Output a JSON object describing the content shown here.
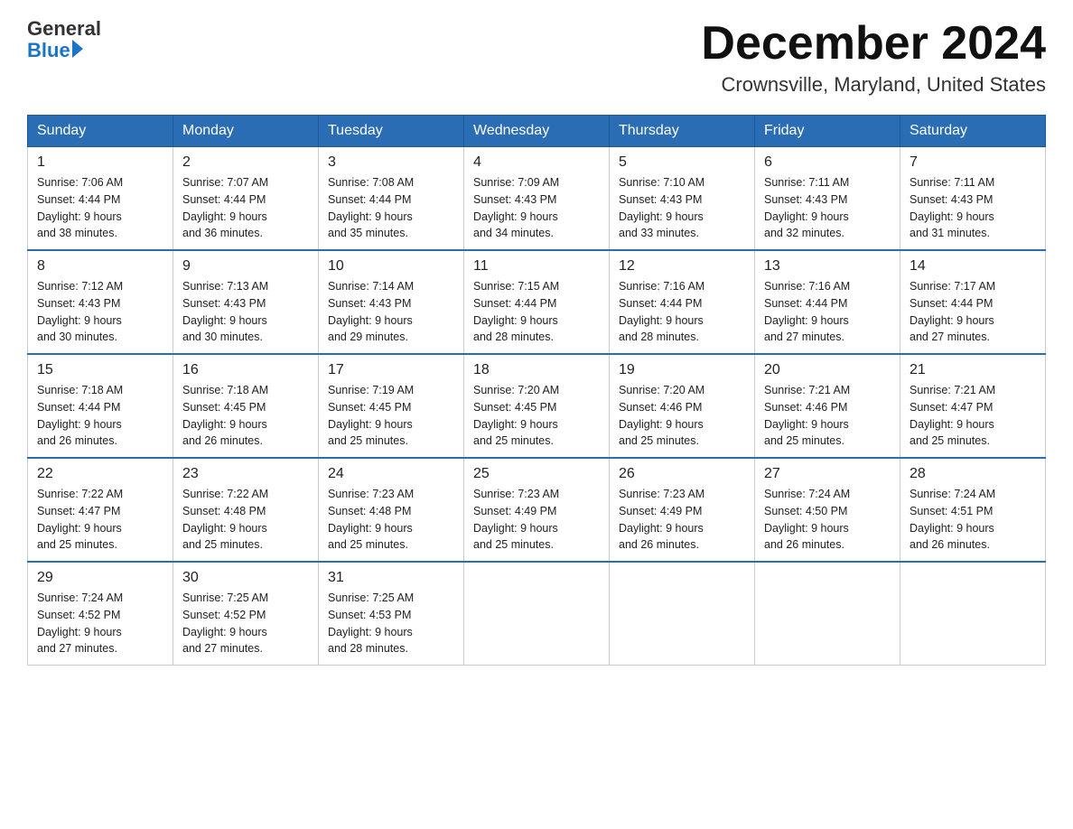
{
  "header": {
    "logo_text1": "General",
    "logo_text2": "Blue",
    "month_title": "December 2024",
    "location": "Crownsville, Maryland, United States"
  },
  "weekdays": [
    "Sunday",
    "Monday",
    "Tuesday",
    "Wednesday",
    "Thursday",
    "Friday",
    "Saturday"
  ],
  "weeks": [
    [
      {
        "day": "1",
        "sunrise": "7:06 AM",
        "sunset": "4:44 PM",
        "daylight": "9 hours and 38 minutes."
      },
      {
        "day": "2",
        "sunrise": "7:07 AM",
        "sunset": "4:44 PM",
        "daylight": "9 hours and 36 minutes."
      },
      {
        "day": "3",
        "sunrise": "7:08 AM",
        "sunset": "4:44 PM",
        "daylight": "9 hours and 35 minutes."
      },
      {
        "day": "4",
        "sunrise": "7:09 AM",
        "sunset": "4:43 PM",
        "daylight": "9 hours and 34 minutes."
      },
      {
        "day": "5",
        "sunrise": "7:10 AM",
        "sunset": "4:43 PM",
        "daylight": "9 hours and 33 minutes."
      },
      {
        "day": "6",
        "sunrise": "7:11 AM",
        "sunset": "4:43 PM",
        "daylight": "9 hours and 32 minutes."
      },
      {
        "day": "7",
        "sunrise": "7:11 AM",
        "sunset": "4:43 PM",
        "daylight": "9 hours and 31 minutes."
      }
    ],
    [
      {
        "day": "8",
        "sunrise": "7:12 AM",
        "sunset": "4:43 PM",
        "daylight": "9 hours and 30 minutes."
      },
      {
        "day": "9",
        "sunrise": "7:13 AM",
        "sunset": "4:43 PM",
        "daylight": "9 hours and 30 minutes."
      },
      {
        "day": "10",
        "sunrise": "7:14 AM",
        "sunset": "4:43 PM",
        "daylight": "9 hours and 29 minutes."
      },
      {
        "day": "11",
        "sunrise": "7:15 AM",
        "sunset": "4:44 PM",
        "daylight": "9 hours and 28 minutes."
      },
      {
        "day": "12",
        "sunrise": "7:16 AM",
        "sunset": "4:44 PM",
        "daylight": "9 hours and 28 minutes."
      },
      {
        "day": "13",
        "sunrise": "7:16 AM",
        "sunset": "4:44 PM",
        "daylight": "9 hours and 27 minutes."
      },
      {
        "day": "14",
        "sunrise": "7:17 AM",
        "sunset": "4:44 PM",
        "daylight": "9 hours and 27 minutes."
      }
    ],
    [
      {
        "day": "15",
        "sunrise": "7:18 AM",
        "sunset": "4:44 PM",
        "daylight": "9 hours and 26 minutes."
      },
      {
        "day": "16",
        "sunrise": "7:18 AM",
        "sunset": "4:45 PM",
        "daylight": "9 hours and 26 minutes."
      },
      {
        "day": "17",
        "sunrise": "7:19 AM",
        "sunset": "4:45 PM",
        "daylight": "9 hours and 25 minutes."
      },
      {
        "day": "18",
        "sunrise": "7:20 AM",
        "sunset": "4:45 PM",
        "daylight": "9 hours and 25 minutes."
      },
      {
        "day": "19",
        "sunrise": "7:20 AM",
        "sunset": "4:46 PM",
        "daylight": "9 hours and 25 minutes."
      },
      {
        "day": "20",
        "sunrise": "7:21 AM",
        "sunset": "4:46 PM",
        "daylight": "9 hours and 25 minutes."
      },
      {
        "day": "21",
        "sunrise": "7:21 AM",
        "sunset": "4:47 PM",
        "daylight": "9 hours and 25 minutes."
      }
    ],
    [
      {
        "day": "22",
        "sunrise": "7:22 AM",
        "sunset": "4:47 PM",
        "daylight": "9 hours and 25 minutes."
      },
      {
        "day": "23",
        "sunrise": "7:22 AM",
        "sunset": "4:48 PM",
        "daylight": "9 hours and 25 minutes."
      },
      {
        "day": "24",
        "sunrise": "7:23 AM",
        "sunset": "4:48 PM",
        "daylight": "9 hours and 25 minutes."
      },
      {
        "day": "25",
        "sunrise": "7:23 AM",
        "sunset": "4:49 PM",
        "daylight": "9 hours and 25 minutes."
      },
      {
        "day": "26",
        "sunrise": "7:23 AM",
        "sunset": "4:49 PM",
        "daylight": "9 hours and 26 minutes."
      },
      {
        "day": "27",
        "sunrise": "7:24 AM",
        "sunset": "4:50 PM",
        "daylight": "9 hours and 26 minutes."
      },
      {
        "day": "28",
        "sunrise": "7:24 AM",
        "sunset": "4:51 PM",
        "daylight": "9 hours and 26 minutes."
      }
    ],
    [
      {
        "day": "29",
        "sunrise": "7:24 AM",
        "sunset": "4:52 PM",
        "daylight": "9 hours and 27 minutes."
      },
      {
        "day": "30",
        "sunrise": "7:25 AM",
        "sunset": "4:52 PM",
        "daylight": "9 hours and 27 minutes."
      },
      {
        "day": "31",
        "sunrise": "7:25 AM",
        "sunset": "4:53 PM",
        "daylight": "9 hours and 28 minutes."
      },
      null,
      null,
      null,
      null
    ]
  ],
  "labels": {
    "sunrise": "Sunrise:",
    "sunset": "Sunset:",
    "daylight": "Daylight:"
  }
}
